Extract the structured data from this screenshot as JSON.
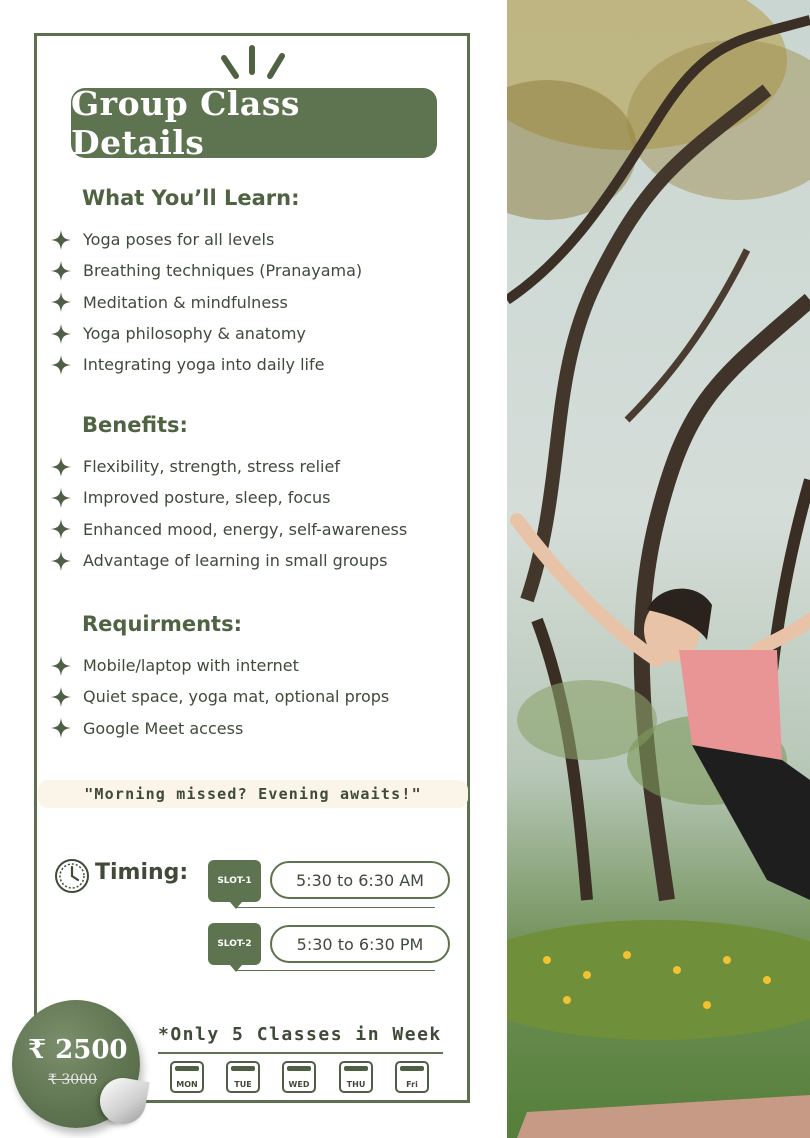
{
  "title": "Group Class Details",
  "learn": {
    "heading": "What You’ll Learn:",
    "items": [
      "Yoga poses for all levels",
      "Breathing techniques (Pranayama)",
      "Meditation & mindfulness",
      "Yoga philosophy & anatomy",
      "Integrating yoga into daily life"
    ]
  },
  "benefits": {
    "heading": "Benefits:",
    "items": [
      "Flexibility, strength, stress relief",
      "Improved posture, sleep, focus",
      "Enhanced mood, energy, self-awareness",
      "Advantage of learning in small groups"
    ]
  },
  "requirements": {
    "heading": "Requirments:",
    "items": [
      "Mobile/laptop with internet",
      "Quiet space, yoga mat, optional props",
      "Google Meet access"
    ]
  },
  "quote": "\"Morning missed? Evening awaits!\"",
  "timing": {
    "label": "Timing:",
    "slots": [
      {
        "tag": "SLOT-1",
        "time": "5:30  to 6:30 AM"
      },
      {
        "tag": "SLOT-2",
        "time": "5:30  to 6:30 PM"
      }
    ]
  },
  "price": {
    "current": "₹ 2500",
    "original": "₹ 3000"
  },
  "week_note": "*Only 5 Classes in Week",
  "days": [
    "MON",
    "TUE",
    "WED",
    "THU",
    "Fri"
  ],
  "colors": {
    "accent": "#5e7350",
    "text": "#3f4a38",
    "quote_bg": "#fbf4e9"
  },
  "icons": {
    "bullet": "sparkle-star-icon",
    "timing": "clock-icon",
    "day": "calendar-icon"
  }
}
